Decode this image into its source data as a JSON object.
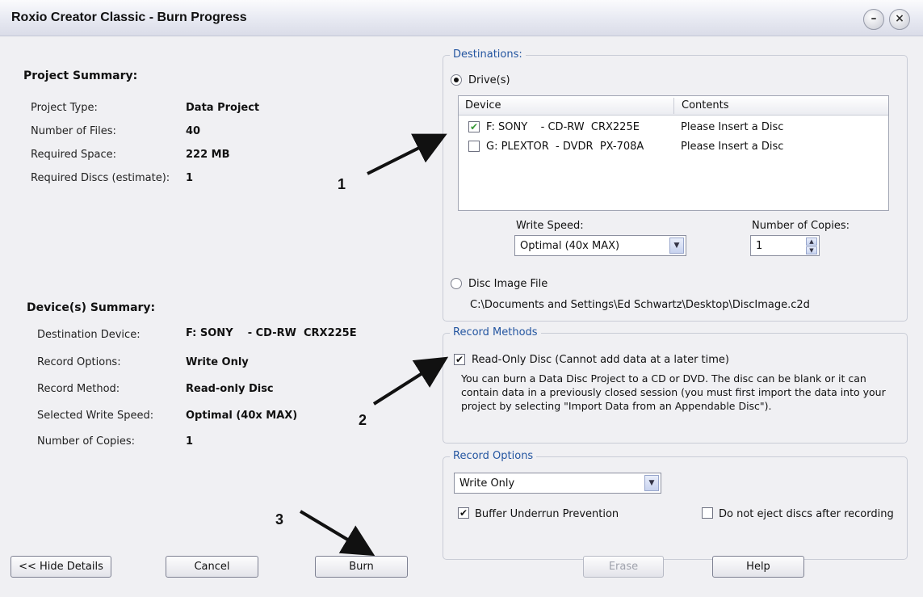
{
  "window": {
    "title": "Roxio Creator Classic - Burn Progress",
    "minimize_glyph": "–",
    "close_glyph": "×"
  },
  "project_summary": {
    "title": "Project Summary:",
    "rows": [
      {
        "label": "Project Type:",
        "value": "Data Project"
      },
      {
        "label": "Number of Files:",
        "value": "40"
      },
      {
        "label": "Required Space:",
        "value": "222 MB"
      },
      {
        "label": "Required Discs (estimate):",
        "value": "1"
      }
    ]
  },
  "device_summary": {
    "title": "Device(s) Summary:",
    "rows": [
      {
        "label": "Destination Device:",
        "value": "F: SONY    - CD-RW  CRX225E"
      },
      {
        "label": "Record Options:",
        "value": "Write Only"
      },
      {
        "label": "Record Method:",
        "value": "Read-only Disc"
      },
      {
        "label": "Selected Write Speed:",
        "value": "Optimal (40x MAX)"
      },
      {
        "label": "Number of Copies:",
        "value": "1"
      }
    ]
  },
  "destinations": {
    "legend": "Destinations:",
    "drives_option": "Drive(s)",
    "drives_selected": true,
    "columns": [
      "Device",
      "Contents"
    ],
    "devices": [
      {
        "checked": true,
        "device": "F: SONY    - CD-RW  CRX225E",
        "contents": "Please Insert a Disc"
      },
      {
        "checked": false,
        "device": "G: PLEXTOR  - DVDR  PX-708A",
        "contents": "Please Insert a Disc"
      }
    ],
    "write_speed_label": "Write Speed:",
    "write_speed_value": "Optimal (40x MAX)",
    "copies_label": "Number of Copies:",
    "copies_value": "1",
    "image_option": "Disc Image File",
    "image_path": "C:\\Documents and Settings\\Ed Schwartz\\Desktop\\DiscImage.c2d"
  },
  "record_methods": {
    "legend": "Record Methods",
    "option": "Read-Only Disc (Cannot add data at a later time)",
    "checked": true,
    "description": "You can burn a Data Disc Project to a CD or DVD. The disc can be blank or it can contain data in a previously closed session (you must first import the data into your project by selecting \"Import Data from an Appendable Disc\")."
  },
  "record_options": {
    "legend": "Record Options",
    "value": "Write Only",
    "buffer_label": "Buffer Underrun Prevention",
    "buffer_checked": true,
    "noeject_label": "Do not eject discs after recording",
    "noeject_checked": false
  },
  "buttons": {
    "hide_details": "<< Hide Details",
    "cancel": "Cancel",
    "burn": "Burn",
    "erase": "Erase",
    "help": "Help"
  },
  "annotations": {
    "one": "1",
    "two": "2",
    "three": "3"
  },
  "icons": {
    "check": "✔",
    "arrow_down": "▼",
    "arrow_up": "▲"
  },
  "colors": {
    "accent": "#2355a0",
    "title_bg": "#e7e9f2"
  }
}
